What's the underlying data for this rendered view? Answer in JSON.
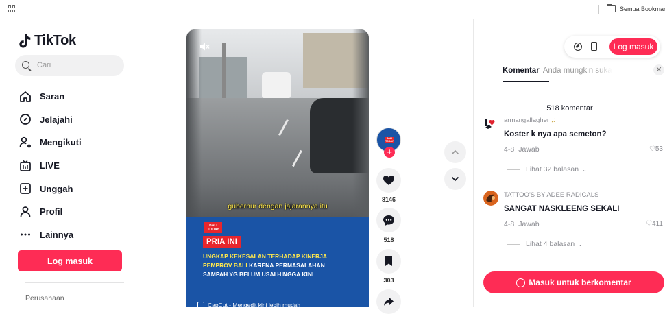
{
  "bookmarks": {
    "folder_label": "Semua Bookmark"
  },
  "sidebar": {
    "logo": "TikTok",
    "search_placeholder": "Cari",
    "items": [
      {
        "label": "Saran",
        "icon": "home-icon"
      },
      {
        "label": "Jelajahi",
        "icon": "compass-icon"
      },
      {
        "label": "Mengikuti",
        "icon": "user-follow-icon"
      },
      {
        "label": "LIVE",
        "icon": "live-icon"
      },
      {
        "label": "Unggah",
        "icon": "upload-icon"
      },
      {
        "label": "Profil",
        "icon": "profile-icon"
      },
      {
        "label": "Lainnya",
        "icon": "more-icon"
      }
    ],
    "login_label": "Log masuk",
    "company_label": "Perusahaan"
  },
  "video": {
    "caption": "gubernur dengan jajarannya itu",
    "news_logo": "BALI TODAY",
    "headline": "PRIA INI",
    "body_line1": "UNGKAP KEKESALAN TERHADAP KINERJA",
    "body_line2_hl": "PEMPROV BALI",
    "body_line2_rest": " KARENA PERMASALAHAN",
    "body_line3": "SAMPAH YG BELUM USAI HINGGA KINI",
    "capcut": "CapCut - Mengedit kini lebih mudah"
  },
  "actions": {
    "like_count": "8146",
    "comment_count": "518",
    "save_count": "303"
  },
  "panel": {
    "login_label": "Log masuk",
    "tab_comments": "Komentar",
    "tab_suggestions": "Anda mungkin suka",
    "comment_count_label": "518 komentar",
    "comments": [
      {
        "user": "armangallagher",
        "text": "Koster k nya apa semeton?",
        "date": "4-8",
        "reply": "Jawab",
        "likes": "53",
        "more": "Lihat 32 balasan"
      },
      {
        "user": "TATTOO'S BY ADEE RADICALS",
        "text": "SANGAT NASKLEENG SEKALI",
        "date": "4-8",
        "reply": "Jawab",
        "likes": "411",
        "more": "Lihat 4 balasan"
      }
    ],
    "comment_button": "Masuk untuk berkomentar"
  },
  "colors": {
    "brand": "#fe2c55",
    "news_blue": "#1a54a6",
    "news_red": "#e8262d",
    "caption_yellow": "#ffe84d"
  }
}
